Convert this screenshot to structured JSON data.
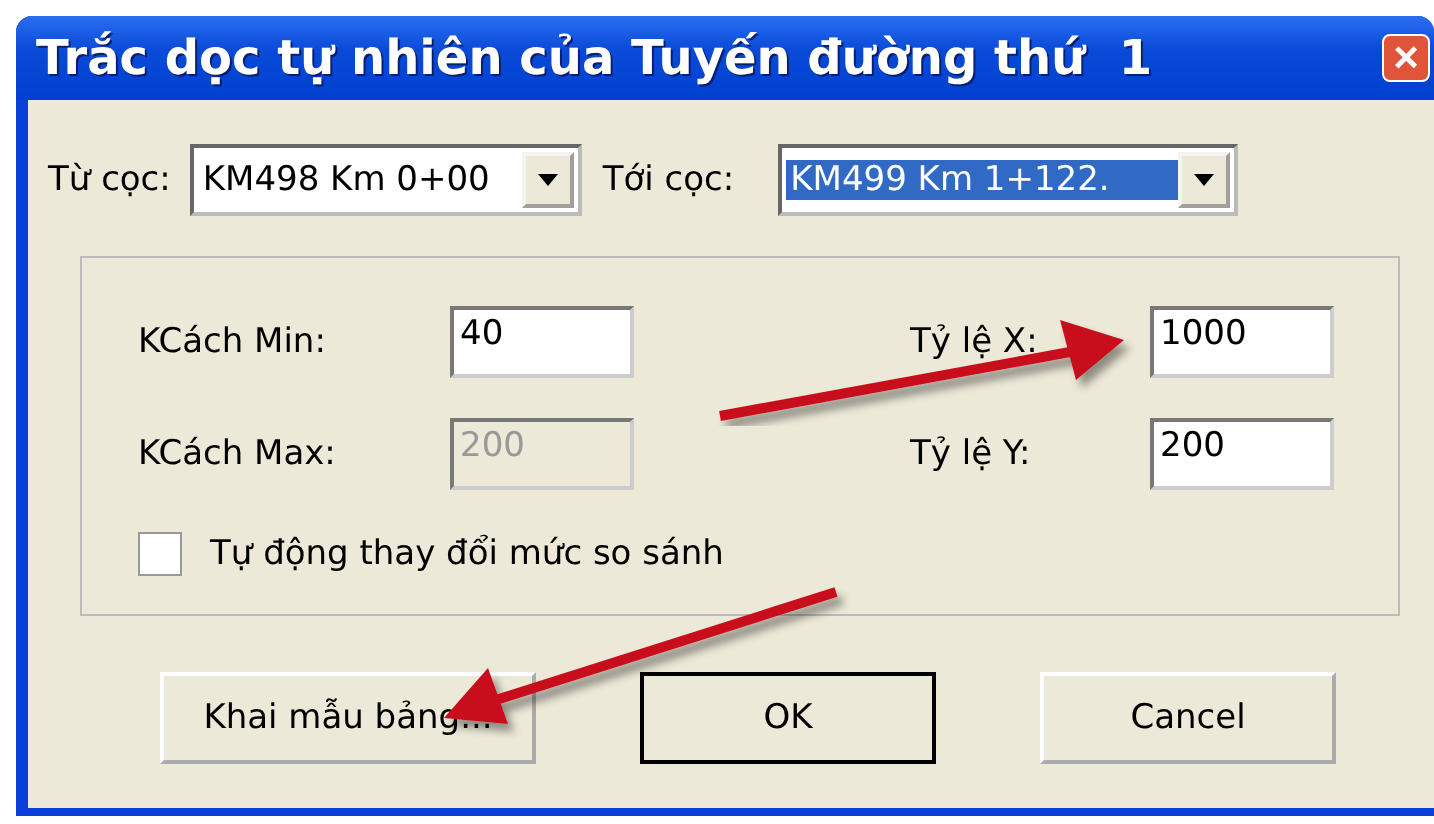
{
  "window": {
    "title": "Trắc dọc tự nhiên của Tuyến đường thứ  1",
    "close": "×"
  },
  "range": [
    {
      "label": "Từ cọc:",
      "value": "KM498 Km 0+00",
      "highlighted": false
    },
    {
      "label": "Tới cọc:",
      "value": "KM499 Km 1+122.",
      "highlighted": true
    }
  ],
  "fields": [
    {
      "label": "KCách Min:",
      "value": "40",
      "disabled": false
    },
    {
      "label": "Tỷ lệ X:",
      "value": "1000",
      "disabled": false
    },
    {
      "label": "KCách Max:",
      "value": "200",
      "disabled": true
    },
    {
      "label": "Tỷ lệ Y:",
      "value": "200",
      "disabled": false
    }
  ],
  "checkbox": {
    "label": "Tự động thay đổi mức so sánh",
    "checked": false
  },
  "buttons": [
    {
      "label": "Khai mẫu bảng...",
      "default": false
    },
    {
      "label": "OK",
      "default": true
    },
    {
      "label": "Cancel",
      "default": false
    }
  ]
}
